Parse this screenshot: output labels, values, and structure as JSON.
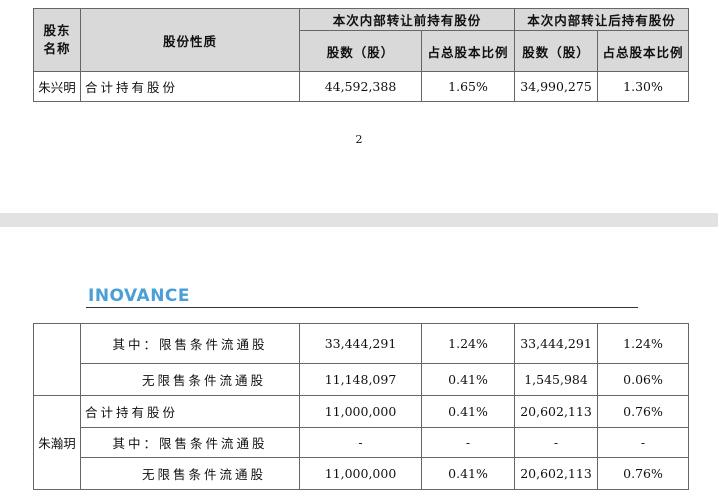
{
  "table1": {
    "header": {
      "holder_name": "股东\n名称",
      "share_type": "股份性质",
      "before_group": "本次内部转让前持有股份",
      "after_group": "本次内部转让后持有股份",
      "shares_before": "股数（股）",
      "ratio_before": "占总股本比例",
      "shares_after": "股数（股）",
      "ratio_after": "占总股本比例"
    },
    "row": {
      "name": "朱兴明",
      "type": "合计持有股份",
      "shares_before": "44,592,388",
      "ratio_before": "1.65%",
      "shares_after": "34,990,275",
      "ratio_after": "1.30%"
    }
  },
  "page_number": "2",
  "logo_text": "INOVANCE",
  "table2": {
    "rows": [
      {
        "type": "其中：限售条件流通股",
        "shares_before": "33,444,291",
        "ratio_before": "1.24%",
        "shares_after": "33,444,291",
        "ratio_after": "1.24%"
      },
      {
        "type": "无限售条件流通股",
        "shares_before": "11,148,097",
        "ratio_before": "0.41%",
        "shares_after": "1,545,984",
        "ratio_after": "0.06%"
      },
      {
        "type": "合计持有股份",
        "shares_before": "11,000,000",
        "ratio_before": "0.41%",
        "shares_after": "20,602,113",
        "ratio_after": "0.76%"
      },
      {
        "type": "其中：限售条件流通股",
        "shares_before": "-",
        "ratio_before": "-",
        "shares_after": "-",
        "ratio_after": "-"
      },
      {
        "type": "无限售条件流通股",
        "shares_before": "11,000,000",
        "ratio_before": "0.41%",
        "shares_after": "20,602,113",
        "ratio_after": "0.76%"
      }
    ],
    "second_holder": "朱瀚玥"
  }
}
